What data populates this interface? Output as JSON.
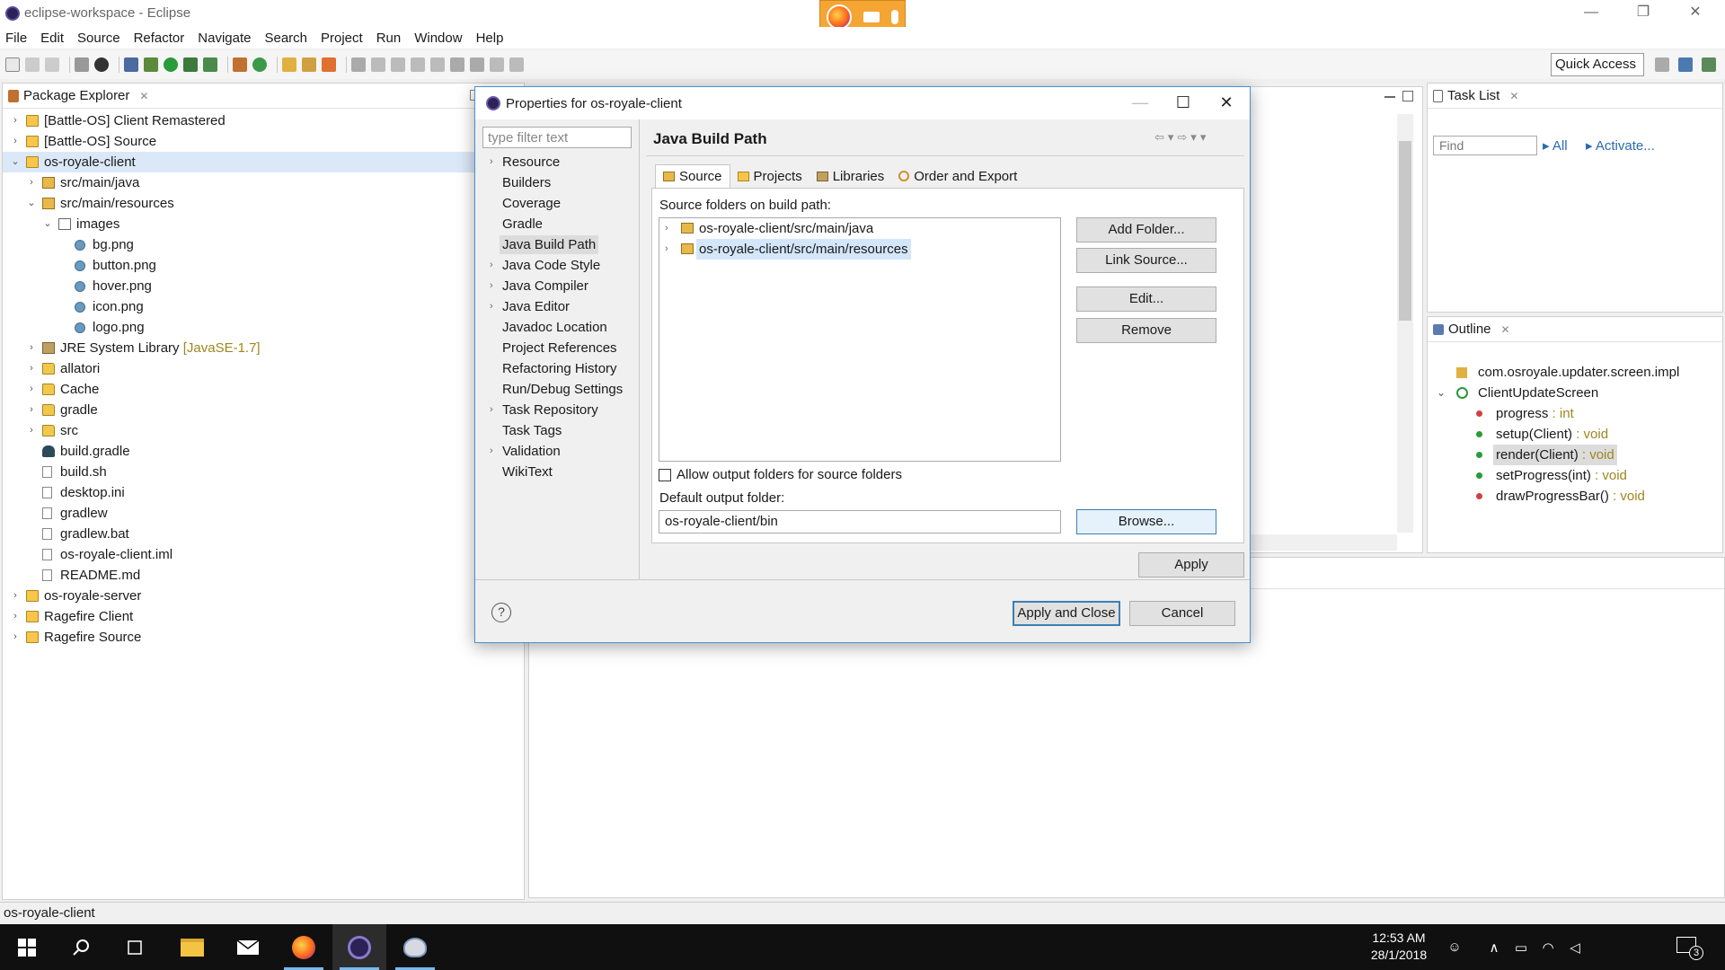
{
  "window": {
    "title": "eclipse-workspace - Eclipse",
    "minimize": "—",
    "restore": "❐",
    "close": "✕"
  },
  "menu": [
    "File",
    "Edit",
    "Source",
    "Refactor",
    "Navigate",
    "Search",
    "Project",
    "Run",
    "Window",
    "Help"
  ],
  "toolbar": {
    "quick_access": "Quick Access"
  },
  "package_explorer": {
    "title": "Package Explorer",
    "tree": [
      {
        "depth": 0,
        "twisty": "›",
        "icon": "project-icon",
        "iconclass": "ic-proj",
        "label": "[Battle-OS] Client Remastered"
      },
      {
        "depth": 0,
        "twisty": "›",
        "icon": "project-icon",
        "iconclass": "ic-proj",
        "label": "[Battle-OS] Source"
      },
      {
        "depth": 0,
        "twisty": "⌄",
        "icon": "project-icon",
        "iconclass": "ic-proj",
        "label": "os-royale-client",
        "selected": true
      },
      {
        "depth": 1,
        "twisty": "›",
        "icon": "source-folder-icon",
        "iconclass": "ic-pkgf",
        "label": "src/main/java"
      },
      {
        "depth": 1,
        "twisty": "⌄",
        "icon": "source-folder-icon",
        "iconclass": "ic-pkgf",
        "label": "src/main/resources"
      },
      {
        "depth": 2,
        "twisty": "⌄",
        "icon": "package-icon",
        "iconclass": "ic-pkg",
        "label": "images"
      },
      {
        "depth": 3,
        "twisty": "",
        "icon": "image-file-icon",
        "iconclass": "ic-img",
        "label": "bg.png"
      },
      {
        "depth": 3,
        "twisty": "",
        "icon": "image-file-icon",
        "iconclass": "ic-img",
        "label": "button.png"
      },
      {
        "depth": 3,
        "twisty": "",
        "icon": "image-file-icon",
        "iconclass": "ic-img",
        "label": "hover.png"
      },
      {
        "depth": 3,
        "twisty": "",
        "icon": "image-file-icon",
        "iconclass": "ic-img",
        "label": "icon.png"
      },
      {
        "depth": 3,
        "twisty": "",
        "icon": "image-file-icon",
        "iconclass": "ic-img",
        "label": "logo.png"
      },
      {
        "depth": 1,
        "twisty": "›",
        "icon": "library-icon",
        "iconclass": "ic-jar",
        "label": "JRE System Library",
        "suffix": " [JavaSE-1.7]"
      },
      {
        "depth": 1,
        "twisty": "›",
        "icon": "folder-icon",
        "iconclass": "ic-folder",
        "label": "allatori"
      },
      {
        "depth": 1,
        "twisty": "›",
        "icon": "folder-icon",
        "iconclass": "ic-folder",
        "label": "Cache"
      },
      {
        "depth": 1,
        "twisty": "›",
        "icon": "folder-icon",
        "iconclass": "ic-folder",
        "label": "gradle"
      },
      {
        "depth": 1,
        "twisty": "›",
        "icon": "folder-icon",
        "iconclass": "ic-folder",
        "label": "src"
      },
      {
        "depth": 1,
        "twisty": "",
        "icon": "gradle-file-icon",
        "iconclass": "ic-gradle",
        "label": "build.gradle"
      },
      {
        "depth": 1,
        "twisty": "",
        "icon": "file-icon",
        "iconclass": "ic-file",
        "label": "build.sh"
      },
      {
        "depth": 1,
        "twisty": "",
        "icon": "file-icon",
        "iconclass": "ic-file",
        "label": "desktop.ini"
      },
      {
        "depth": 1,
        "twisty": "",
        "icon": "file-icon",
        "iconclass": "ic-file",
        "label": "gradlew"
      },
      {
        "depth": 1,
        "twisty": "",
        "icon": "file-icon",
        "iconclass": "ic-file",
        "label": "gradlew.bat"
      },
      {
        "depth": 1,
        "twisty": "",
        "icon": "file-icon",
        "iconclass": "ic-file",
        "label": "os-royale-client.iml"
      },
      {
        "depth": 1,
        "twisty": "",
        "icon": "file-icon",
        "iconclass": "ic-file",
        "label": "README.md"
      },
      {
        "depth": 0,
        "twisty": "›",
        "icon": "project-icon",
        "iconclass": "ic-proj",
        "label": "os-royale-server"
      },
      {
        "depth": 0,
        "twisty": "›",
        "icon": "project-icon",
        "iconclass": "ic-proj",
        "label": "Ragefire Client"
      },
      {
        "depth": 0,
        "twisty": "›",
        "icon": "project-icon",
        "iconclass": "ic-proj",
        "label": "Ragefire Source"
      }
    ]
  },
  "task_list": {
    "title": "Task List",
    "find_placeholder": "Find",
    "all": "All",
    "activate": "Activate..."
  },
  "outline": {
    "title": "Outline",
    "package": "com.osroyale.updater.screen.impl",
    "class": "ClientUpdateScreen",
    "members": [
      {
        "name": "progress",
        "type": " : int",
        "color": "#d04040",
        "selected": false
      },
      {
        "name": "setup(Client)",
        "type": " : void",
        "color": "#2a9a3a",
        "selected": false
      },
      {
        "name": "render(Client)",
        "type": " : void",
        "color": "#2a9a3a",
        "selected": true
      },
      {
        "name": "setProgress(int)",
        "type": " : void",
        "color": "#2a9a3a",
        "selected": false
      },
      {
        "name": "drawProgressBar()",
        "type": " : void",
        "color": "#d04040",
        "selected": false
      }
    ]
  },
  "dialog": {
    "title": "Properties for os-royale-client",
    "filter_placeholder": "type filter text",
    "nav": [
      {
        "label": "Resource",
        "twisty": "›"
      },
      {
        "label": "Builders",
        "twisty": ""
      },
      {
        "label": "Coverage",
        "twisty": ""
      },
      {
        "label": "Gradle",
        "twisty": ""
      },
      {
        "label": "Java Build Path",
        "twisty": "",
        "selected": true
      },
      {
        "label": "Java Code Style",
        "twisty": "›"
      },
      {
        "label": "Java Compiler",
        "twisty": "›"
      },
      {
        "label": "Java Editor",
        "twisty": "›"
      },
      {
        "label": "Javadoc Location",
        "twisty": ""
      },
      {
        "label": "Project References",
        "twisty": ""
      },
      {
        "label": "Refactoring History",
        "twisty": ""
      },
      {
        "label": "Run/Debug Settings",
        "twisty": ""
      },
      {
        "label": "Task Repository",
        "twisty": "›"
      },
      {
        "label": "Task Tags",
        "twisty": ""
      },
      {
        "label": "Validation",
        "twisty": "›"
      },
      {
        "label": "WikiText",
        "twisty": ""
      }
    ],
    "page_title": "Java Build Path",
    "tabs": [
      "Source",
      "Projects",
      "Libraries",
      "Order and Export"
    ],
    "source_label": "Source folders on build path:",
    "source_folders": [
      {
        "label": "os-royale-client/src/main/java",
        "selected": false
      },
      {
        "label": "os-royale-client/src/main/resources",
        "selected": true
      }
    ],
    "buttons": {
      "add_folder": "Add Folder...",
      "link_source": "Link Source...",
      "edit": "Edit...",
      "remove": "Remove",
      "browse": "Browse...",
      "apply": "Apply",
      "apply_close": "Apply and Close",
      "cancel": "Cancel"
    },
    "allow_output": "Allow output folders for source folders",
    "default_output_label": "Default output folder:",
    "default_output_value": "os-royale-client/bin"
  },
  "status": {
    "text": "os-royale-client"
  },
  "taskbar": {
    "time": "12:53 AM",
    "date": "28/1/2018",
    "notifications": "3"
  }
}
